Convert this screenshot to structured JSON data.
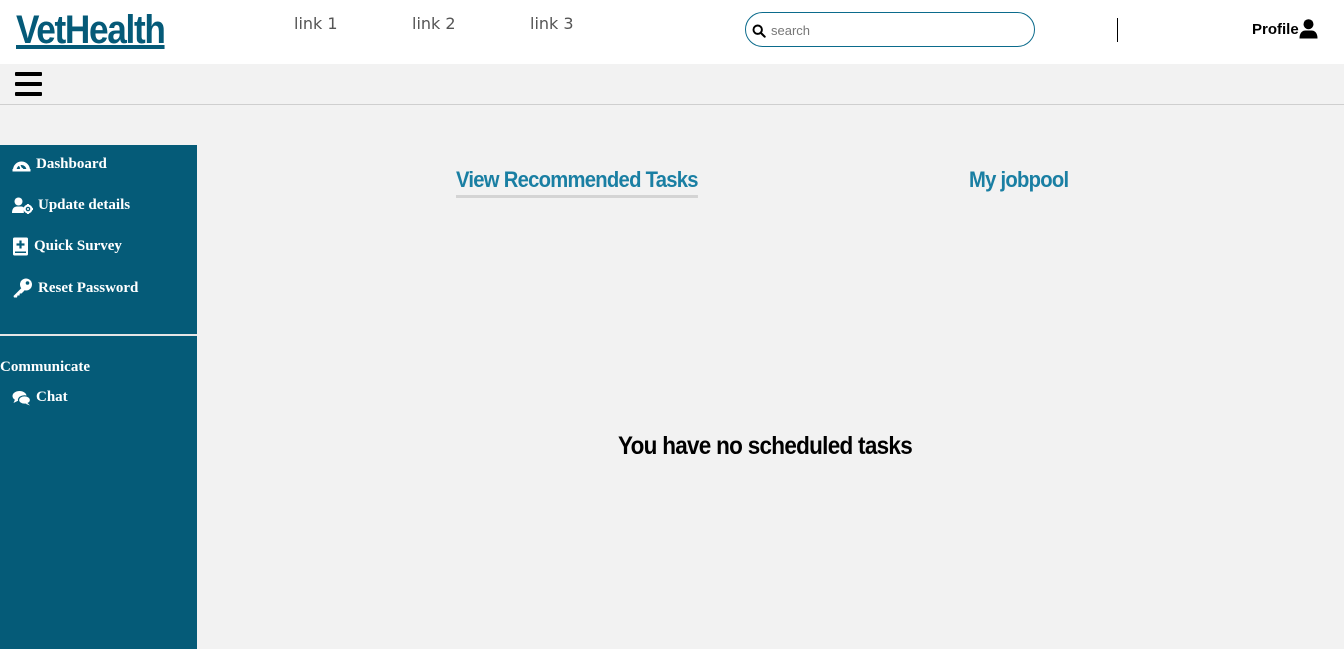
{
  "header": {
    "brand": "VetHealth",
    "links": [
      {
        "label": "link 1"
      },
      {
        "label": "link 2"
      },
      {
        "label": "link 3"
      }
    ],
    "search": {
      "placeholder": "search",
      "value": ""
    },
    "profile_label": "Profile"
  },
  "sidebar": {
    "items": [
      {
        "label": "Dashboard",
        "icon": "dashboard-icon"
      },
      {
        "label": "Update details",
        "icon": "user-cog-icon"
      },
      {
        "label": "Quick Survey",
        "icon": "medical-book-icon"
      },
      {
        "label": "Reset Password",
        "icon": "key-icon"
      }
    ],
    "section_heading": "Communicate",
    "communicate_items": [
      {
        "label": "Chat",
        "icon": "chat-icon"
      }
    ]
  },
  "main": {
    "tabs": [
      {
        "label": "View Recommended Tasks",
        "active": true
      },
      {
        "label": "My jobpool",
        "active": false
      }
    ],
    "empty_message": "You have no scheduled tasks"
  },
  "colors": {
    "brand": "#055a78",
    "sidebar_bg": "#055b78",
    "tab_text": "#1a7fa3",
    "page_bg": "#f2f2f2"
  }
}
